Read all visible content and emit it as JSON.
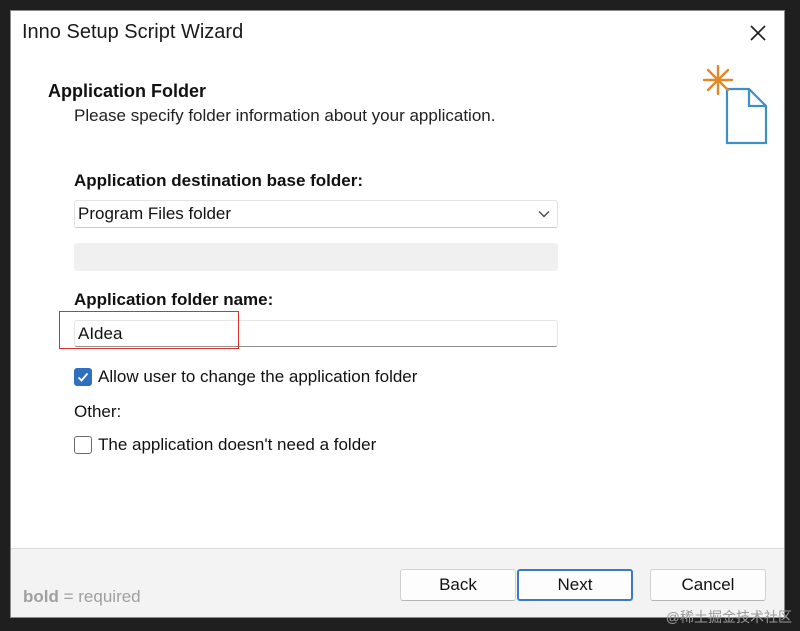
{
  "window": {
    "title": "Inno Setup Script Wizard"
  },
  "page": {
    "heading": "Application Folder",
    "subheading": "Please specify folder information about your application."
  },
  "base_folder": {
    "label": "Application destination base folder:",
    "selected": "Program Files folder"
  },
  "folder_name": {
    "label": "Application folder name:",
    "value": "AIdea"
  },
  "allow_change": {
    "label": "Allow user to change the application folder",
    "checked": true
  },
  "other": {
    "label": "Other:"
  },
  "no_folder": {
    "label": "The application doesn't need a folder",
    "checked": false
  },
  "footer": {
    "legend_bold": "bold",
    "legend_rest": " = required",
    "back_label": "Back",
    "next_label": "Next",
    "cancel_label": "Cancel"
  },
  "watermark": "@稀土掘金技术社区",
  "colors": {
    "accent": "#2e6fc0",
    "highlight": "#d9302c"
  },
  "icons": {
    "close": "close-icon",
    "chevron": "chevron-down-icon",
    "wizard": "new-document-sparkle-icon",
    "check": "checkmark-icon"
  }
}
